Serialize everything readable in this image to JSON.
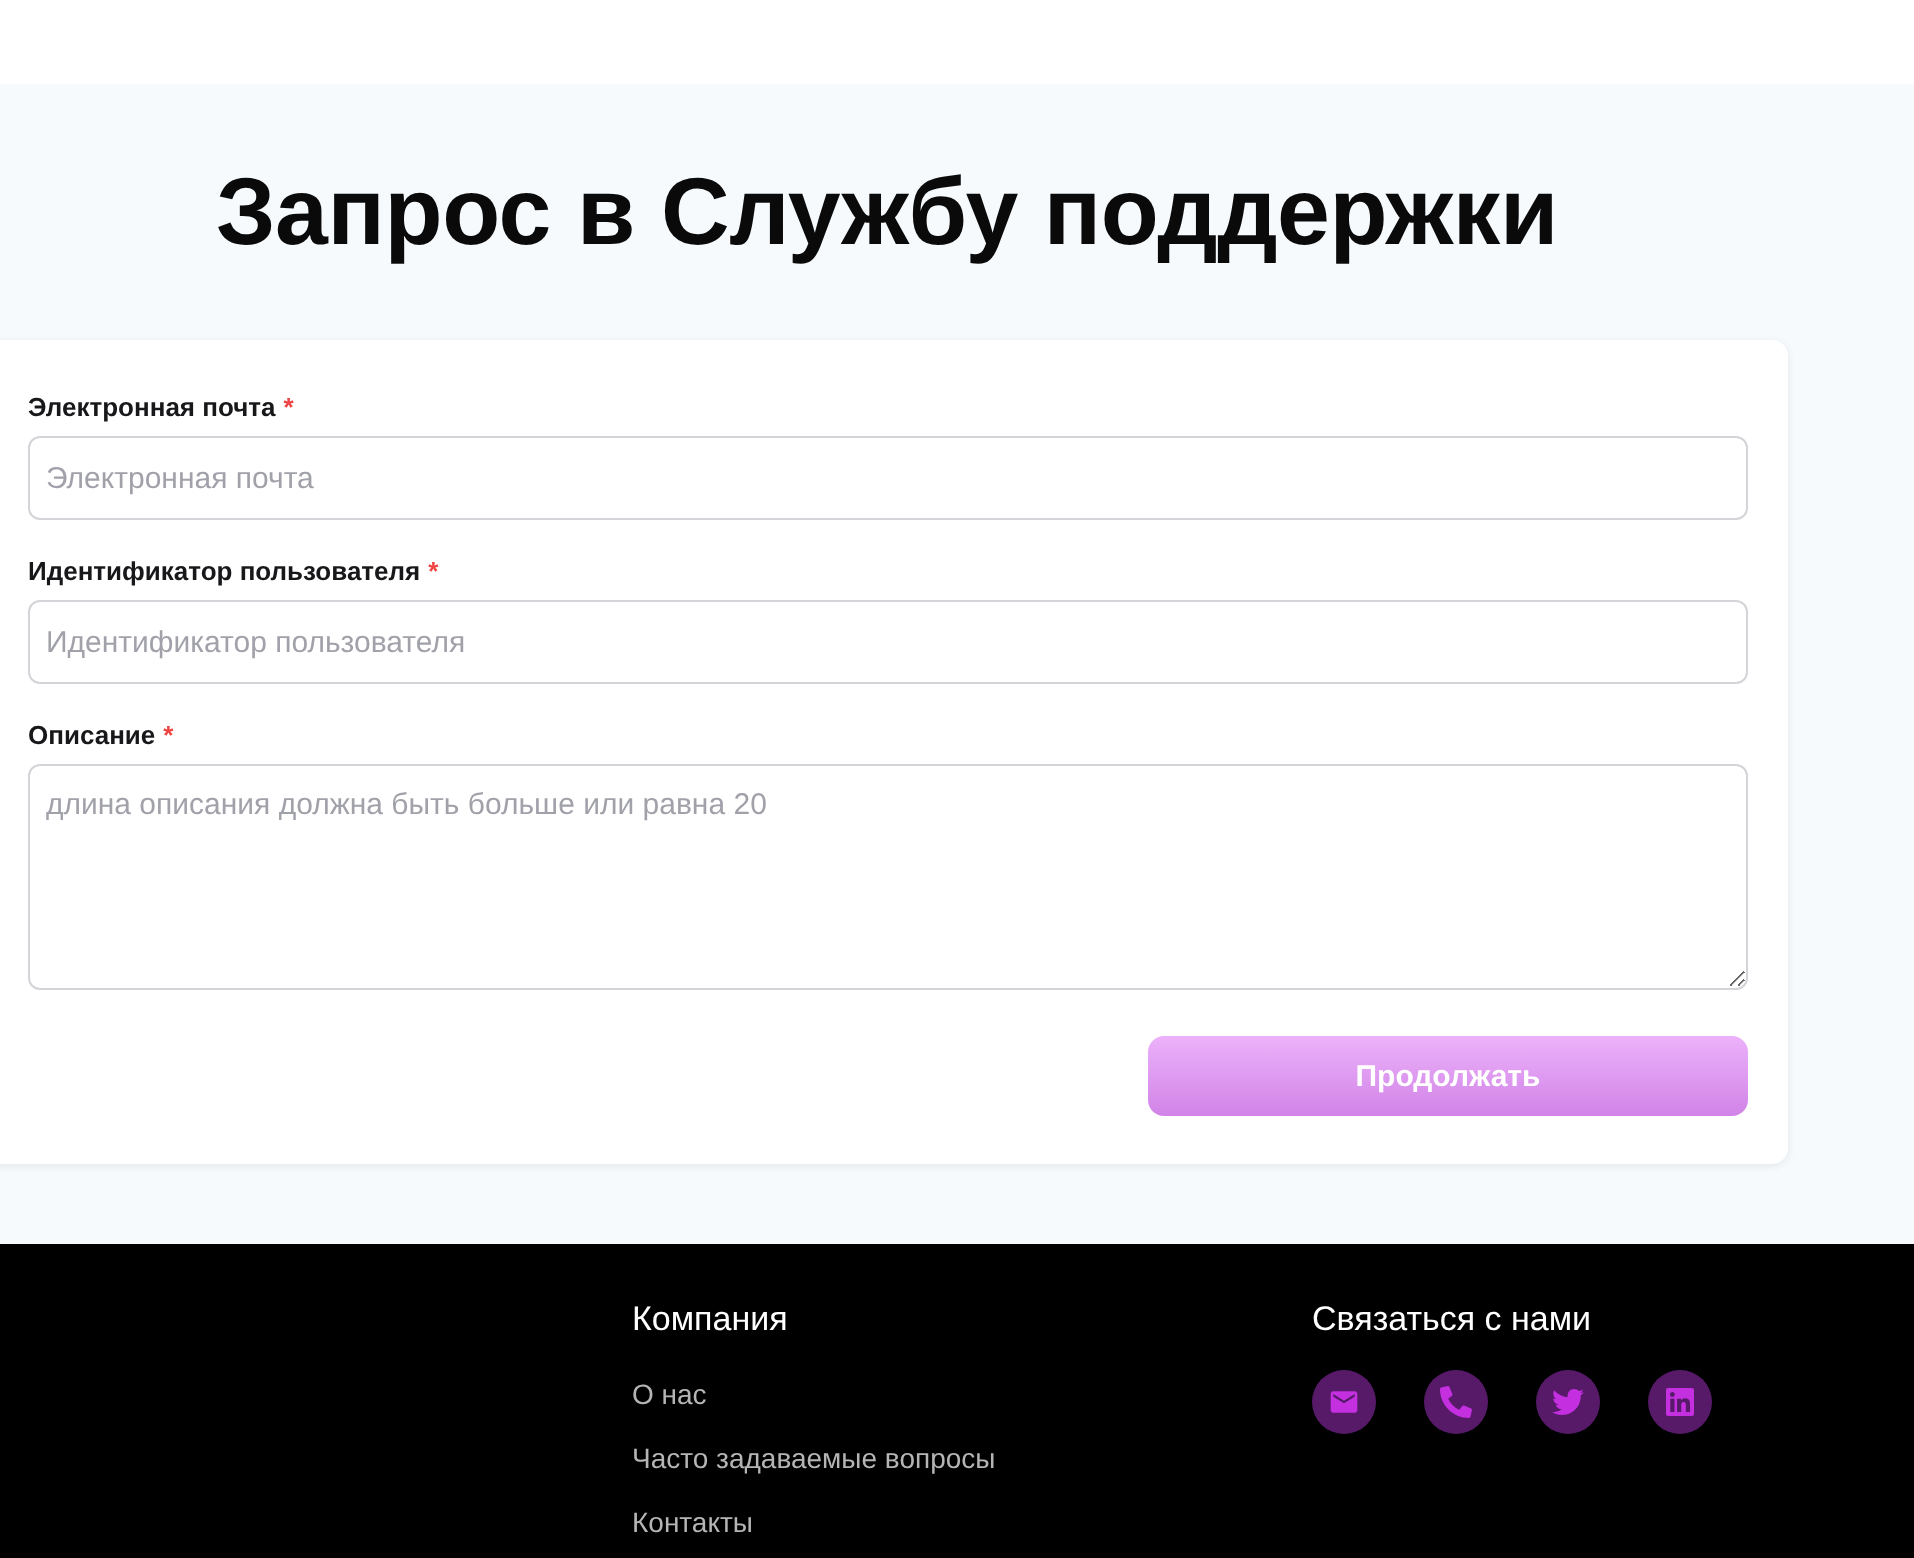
{
  "page": {
    "title": "Запрос в Службу поддержки"
  },
  "form": {
    "fields": [
      {
        "kind": "input",
        "label": "Электронная почта",
        "required_mark": "*",
        "placeholder": "Электронная почта"
      },
      {
        "kind": "input",
        "label": "Идентификатор пользователя",
        "required_mark": "*",
        "placeholder": "Идентификатор пользователя"
      },
      {
        "kind": "textarea",
        "label": "Описание",
        "required_mark": "*",
        "placeholder": "длина описания должна быть больше или равна 20"
      }
    ],
    "submit_button": {
      "label": "Продолжать"
    }
  },
  "footer": {
    "columns": [
      {
        "kind": "links",
        "heading": "Компания",
        "links": [
          "О нас",
          "Часто задаваемые вопросы",
          "Контакты"
        ]
      },
      {
        "kind": "social",
        "heading": "Связаться с нами"
      }
    ]
  }
}
